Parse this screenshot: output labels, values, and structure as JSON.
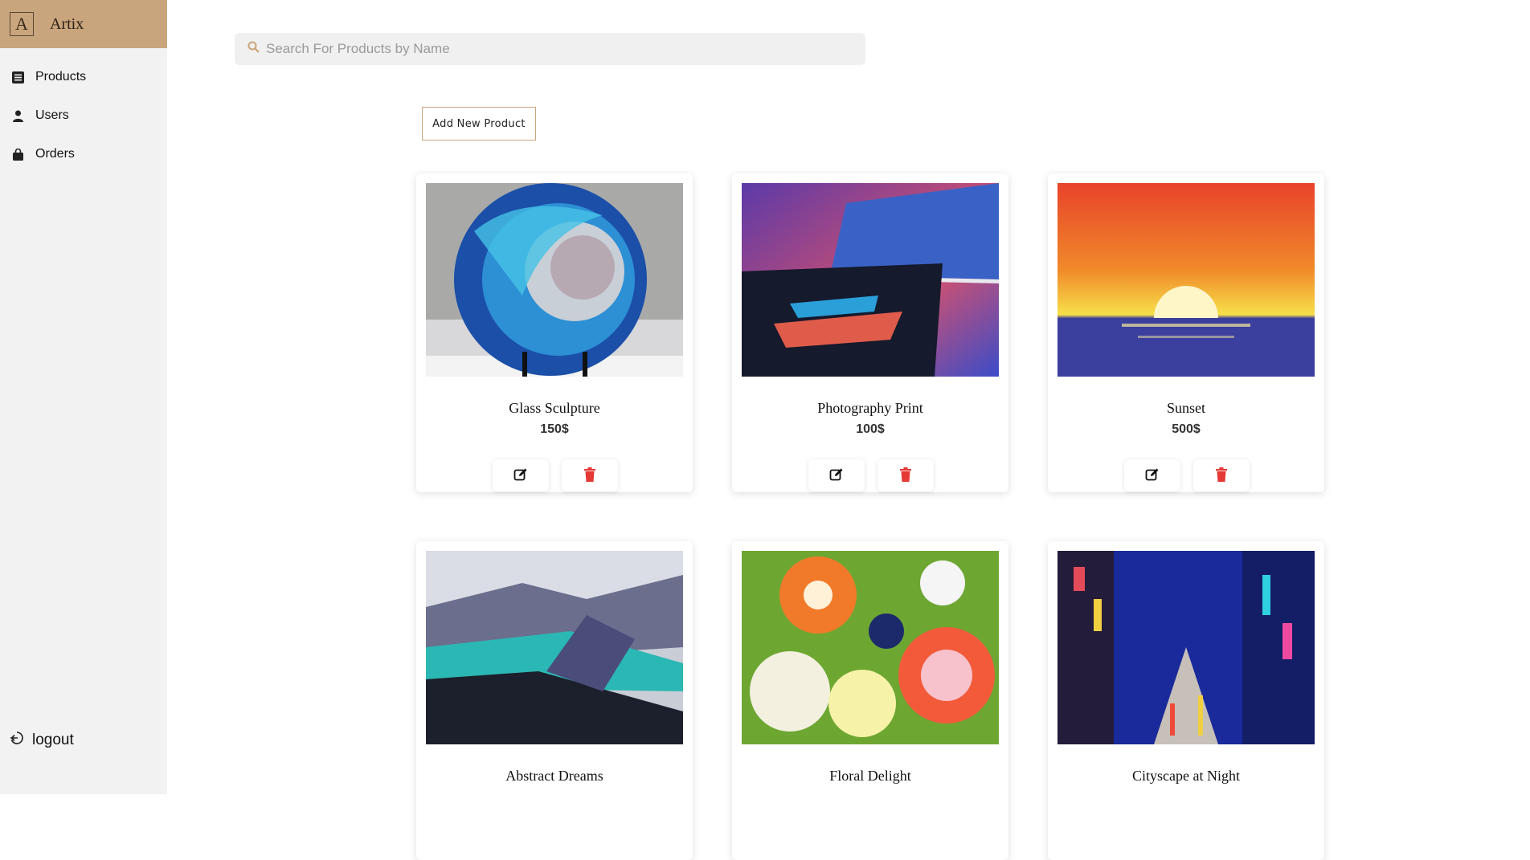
{
  "brand": {
    "logo_letter": "A",
    "name": "Artix"
  },
  "sidebar": {
    "items": [
      {
        "label": "Products",
        "icon": "list-icon"
      },
      {
        "label": "Users",
        "icon": "user-icon"
      },
      {
        "label": "Orders",
        "icon": "shopping-bag-icon"
      }
    ],
    "logout_label": "logout"
  },
  "search": {
    "placeholder": "Search For Products by Name",
    "value": ""
  },
  "toolbar": {
    "add_label": "Add New Product"
  },
  "products": [
    {
      "name": "Glass Sculpture",
      "price": "150$"
    },
    {
      "name": "Photography Print",
      "price": "100$"
    },
    {
      "name": "Sunset",
      "price": "500$"
    },
    {
      "name": "Abstract Dreams",
      "price": ""
    },
    {
      "name": "Floral Delight",
      "price": ""
    },
    {
      "name": "Cityscape at Night",
      "price": ""
    }
  ],
  "colors": {
    "brand": "#c9a57d",
    "sidebar_bg": "#f2f2f2",
    "delete": "#e53935"
  }
}
